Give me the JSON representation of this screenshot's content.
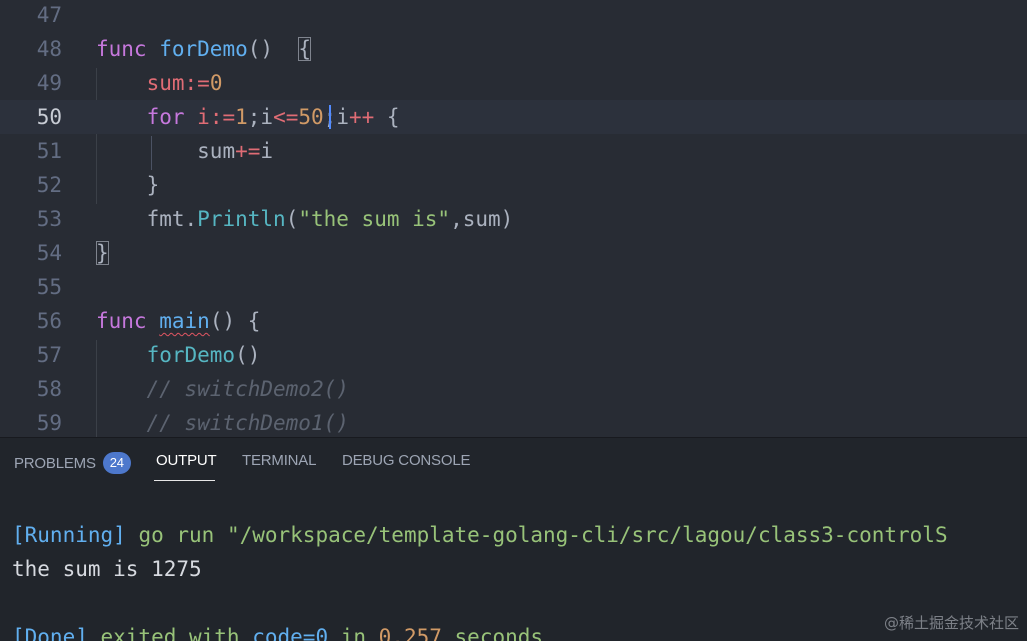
{
  "colors": {
    "editor_bg": "#282c34",
    "panel_bg": "#21252b",
    "keyword": "#c678dd",
    "function": "#61afef",
    "variable": "#e06c75",
    "number": "#d19a66",
    "operator": "#56b6c2",
    "string": "#98c379",
    "comment": "#5c6370",
    "badge": "#4d78cc"
  },
  "editor": {
    "lines": [
      {
        "num": "47",
        "tokens": []
      },
      {
        "num": "48",
        "tokens": [
          {
            "t": "func",
            "c": "kw"
          },
          {
            "t": " ",
            "c": "plain"
          },
          {
            "t": "forDemo",
            "c": "fn"
          },
          {
            "t": "()",
            "c": "pun"
          },
          {
            "t": "  ",
            "c": "plain"
          },
          {
            "t": "{",
            "c": "pun",
            "match": true
          }
        ]
      },
      {
        "num": "49",
        "tokens": [
          {
            "t": "    ",
            "c": "plain"
          },
          {
            "t": "sum",
            "c": "var"
          },
          {
            "t": ":=",
            "c": "var"
          },
          {
            "t": "0",
            "c": "num"
          }
        ]
      },
      {
        "num": "50",
        "tokens": [
          {
            "t": "    ",
            "c": "plain"
          },
          {
            "t": "for",
            "c": "kw"
          },
          {
            "t": " ",
            "c": "plain"
          },
          {
            "t": "i",
            "c": "var"
          },
          {
            "t": ":=",
            "c": "var"
          },
          {
            "t": "1",
            "c": "num"
          },
          {
            "t": ";i",
            "c": "pun"
          },
          {
            "t": "<=",
            "c": "var"
          },
          {
            "t": "50",
            "c": "num"
          },
          {
            "t": ";i",
            "c": "pun"
          },
          {
            "t": "++",
            "c": "var"
          },
          {
            "t": " {",
            "c": "pun"
          }
        ]
      },
      {
        "num": "51",
        "tokens": [
          {
            "t": "        ",
            "c": "plain"
          },
          {
            "t": "sum",
            "c": "pun"
          },
          {
            "t": "+=",
            "c": "var"
          },
          {
            "t": "i",
            "c": "pun"
          }
        ]
      },
      {
        "num": "52",
        "tokens": [
          {
            "t": "    ",
            "c": "plain"
          },
          {
            "t": "}",
            "c": "pun"
          }
        ]
      },
      {
        "num": "53",
        "tokens": [
          {
            "t": "    ",
            "c": "plain"
          },
          {
            "t": "fmt",
            "c": "pun"
          },
          {
            "t": ".",
            "c": "pun"
          },
          {
            "t": "Println",
            "c": "op"
          },
          {
            "t": "(",
            "c": "pun"
          },
          {
            "t": "\"the sum is\"",
            "c": "str"
          },
          {
            "t": ",sum)",
            "c": "pun"
          }
        ]
      },
      {
        "num": "54",
        "tokens": [
          {
            "t": "}",
            "c": "pun",
            "match": true
          }
        ]
      },
      {
        "num": "55",
        "tokens": []
      },
      {
        "num": "56",
        "tokens": [
          {
            "t": "func",
            "c": "kw"
          },
          {
            "t": " ",
            "c": "plain"
          },
          {
            "t": "main",
            "c": "fn",
            "squiggle": true
          },
          {
            "t": "() {",
            "c": "pun"
          }
        ]
      },
      {
        "num": "57",
        "tokens": [
          {
            "t": "    ",
            "c": "plain"
          },
          {
            "t": "forDemo",
            "c": "op"
          },
          {
            "t": "()",
            "c": "pun"
          }
        ]
      },
      {
        "num": "58",
        "tokens": [
          {
            "t": "    ",
            "c": "plain"
          },
          {
            "t": "// switchDemo2()",
            "c": "com"
          }
        ]
      },
      {
        "num": "59",
        "tokens": [
          {
            "t": "    ",
            "c": "plain"
          },
          {
            "t": "// switchDemo1()",
            "c": "com"
          }
        ]
      }
    ],
    "active_line": "50"
  },
  "panel": {
    "tabs": [
      {
        "label": "PROBLEMS",
        "badge": "24"
      },
      {
        "label": "OUTPUT"
      },
      {
        "label": "TERMINAL"
      },
      {
        "label": "DEBUG CONSOLE"
      }
    ],
    "active_tab": "OUTPUT",
    "output": [
      {
        "segments": [
          {
            "t": "[Running]",
            "c": "blue"
          },
          {
            "t": " go run \"/workspace/template-golang-cli/src/lagou/class3-controlS",
            "c": "green"
          }
        ]
      },
      {
        "segments": [
          {
            "t": "the sum is 1275",
            "c": "white"
          }
        ]
      },
      {
        "segments": []
      },
      {
        "segments": [
          {
            "t": "[Done]",
            "c": "blue"
          },
          {
            "t": " exited with ",
            "c": "green"
          },
          {
            "t": "code=0",
            "c": "blue"
          },
          {
            "t": " in ",
            "c": "green"
          },
          {
            "t": "0.257",
            "c": "num"
          },
          {
            "t": " seconds",
            "c": "green"
          }
        ]
      }
    ]
  },
  "watermark": "@稀土掘金技术社区"
}
